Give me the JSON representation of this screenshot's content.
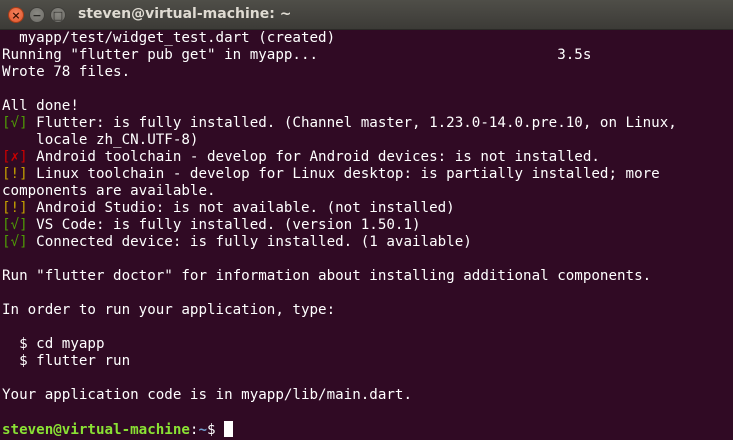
{
  "window": {
    "title": "steven@virtual-machine: ~",
    "close_glyph": "×",
    "minimize_glyph": "−",
    "maximize_glyph": "□"
  },
  "terminal": {
    "colors": {
      "background": "#300a24",
      "text": "#ffffff",
      "ok": "#4e9a06",
      "error": "#cc0000",
      "warning": "#c4a000",
      "prompt_user": "#8ae234",
      "prompt_path": "#729fcf"
    },
    "lines": [
      "  myapp/test/widget_test.dart (created)",
      "Running \"flutter pub get\" in myapp...                            3.5s",
      "Wrote 78 files.",
      "",
      "All done!",
      "",
      " Flutter: is fully installed. (Channel master, 1.23.0-14.0.pre.10, on Linux,",
      "    locale zh_CN.UTF-8)",
      "",
      " Android toolchain - develop for Android devices: is not installed.",
      "",
      " Linux toolchain - develop for Linux desktop: is partially installed; more",
      "components are available.",
      "",
      " Android Studio: is not available. (not installed)",
      "",
      " VS Code: is fully installed. (version 1.50.1)",
      "",
      " Connected device: is fully installed. (1 available)",
      "",
      "Run \"flutter doctor\" for information about installing additional components.",
      "",
      "In order to run your application, type:",
      "",
      "  $ cd myapp",
      "  $ flutter run",
      "",
      "Your application code is in myapp/lib/main.dart.",
      "",
      ""
    ],
    "badges": {
      "ok": "[√]",
      "error": "[✗]",
      "warning": "[!]"
    },
    "prompt": {
      "user_host": "steven@virtual-machine",
      "colon": ":",
      "path": "~",
      "symbol": "$ "
    }
  }
}
